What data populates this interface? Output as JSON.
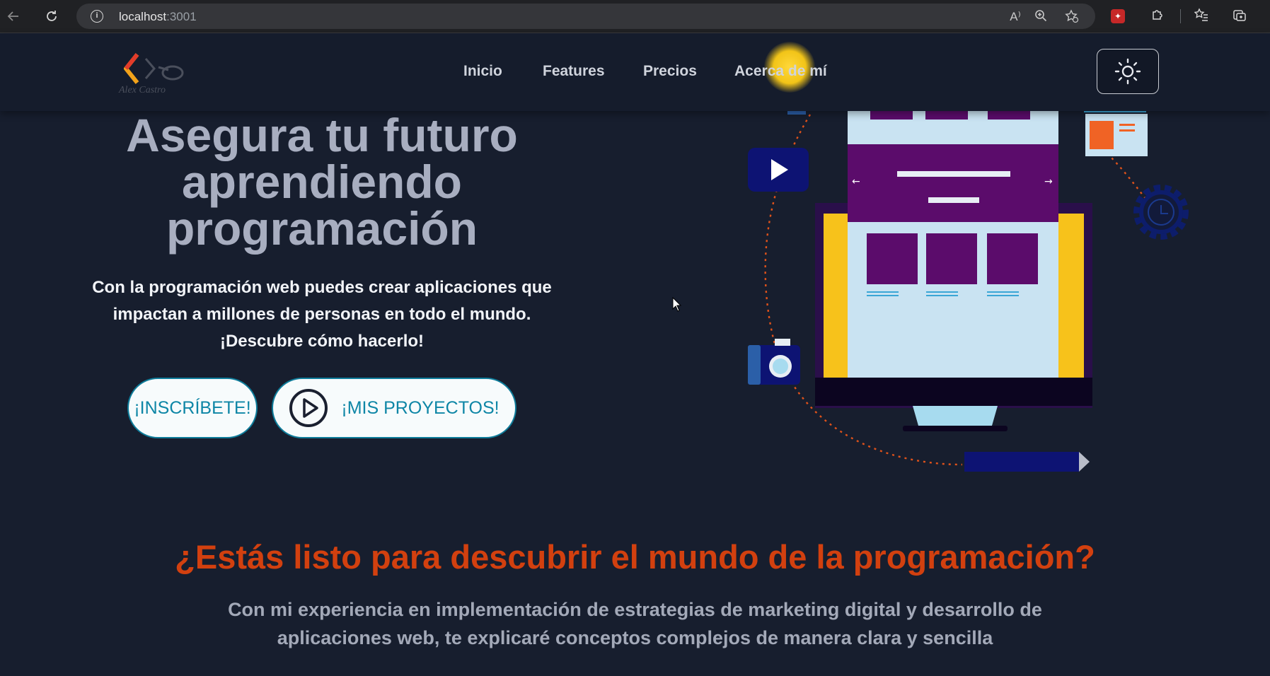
{
  "browser": {
    "url_host": "localhost",
    "url_port": ":3001",
    "info_icon": "info-icon",
    "read_aloud_label": "A⁾"
  },
  "header": {
    "logo_text": "Alex Castro",
    "nav": [
      {
        "label": "Inicio"
      },
      {
        "label": "Features"
      },
      {
        "label": "Precios"
      },
      {
        "label": "Acerca de mí"
      }
    ],
    "theme_icon": "sun-icon"
  },
  "hero": {
    "title": "Asegura tu futuro aprendiendo programación",
    "subtitle_line1": "Con la programación web puedes crear aplicaciones que",
    "subtitle_line2": "impactan a millones de personas en todo el mundo.",
    "subtitle_line3": "¡Descubre cómo hacerlo!",
    "signup_label": "¡INSCRÍBETE!",
    "projects_label": "¡MIS PROYECTOS!"
  },
  "section2": {
    "title": "¿Estás listo para descubrir el mundo de la programación?",
    "text_line1": "Con mi experiencia en implementación de estrategias de marketing digital y desarrollo de",
    "text_line2": "aplicaciones web, te explicaré conceptos complejos de manera clara y sencilla"
  },
  "colors": {
    "background": "#171e2e",
    "accent_orange": "#d2400f",
    "button_text": "#0e86a6",
    "monitor_purple": "#5b0c6b",
    "monitor_yellow": "#f7c21b"
  }
}
